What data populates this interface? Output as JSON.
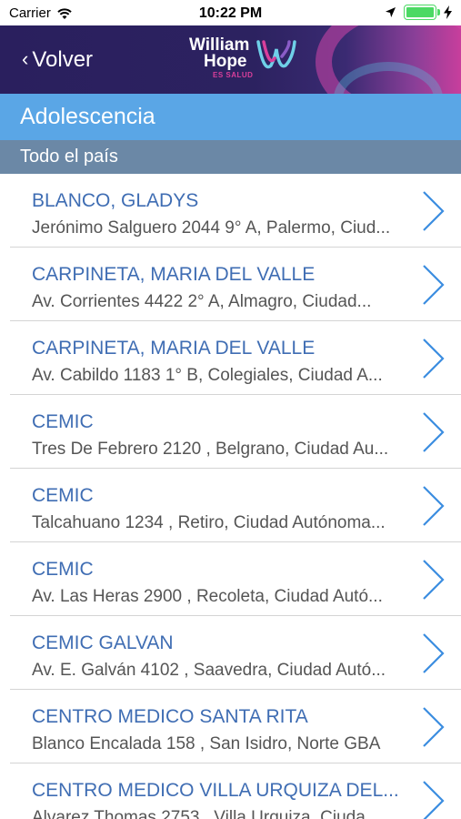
{
  "status_bar": {
    "carrier": "Carrier",
    "time": "10:22 PM",
    "battery_level": 1.0,
    "battery_color": "#4cd964"
  },
  "nav": {
    "back_label": "Volver",
    "back_icon": "chevron-left-icon",
    "logo_line1": "William",
    "logo_line2": "Hope",
    "logo_tagline": "ES SALUD",
    "brand_colors": {
      "primary": "#2a1f5e",
      "accent_pink": "#d93f9b",
      "accent_blue": "#5aa6e6"
    }
  },
  "section": {
    "title": "Adolescencia",
    "region": "Todo el país"
  },
  "providers": [
    {
      "name": "BLANCO, GLADYS",
      "address": "Jerónimo Salguero 2044 9° A, Palermo, Ciud..."
    },
    {
      "name": "CARPINETA, MARIA DEL VALLE",
      "address": "Av. Corrientes 4422 2° A, Almagro, Ciudad..."
    },
    {
      "name": "CARPINETA, MARIA DEL VALLE",
      "address": "Av. Cabildo 1183 1° B, Colegiales, Ciudad A..."
    },
    {
      "name": "CEMIC",
      "address": "Tres De Febrero 2120 , Belgrano, Ciudad Au..."
    },
    {
      "name": "CEMIC",
      "address": "Talcahuano 1234 , Retiro, Ciudad Autónoma..."
    },
    {
      "name": "CEMIC",
      "address": "Av. Las Heras 2900  , Recoleta, Ciudad Autó..."
    },
    {
      "name": "CEMIC GALVAN",
      "address": "Av. E. Galván 4102 , Saavedra, Ciudad Autó..."
    },
    {
      "name": "CENTRO MEDICO SANTA RITA",
      "address": "Blanco Encalada 158 , San Isidro, Norte GBA"
    },
    {
      "name": "CENTRO MEDICO VILLA URQUIZA DEL...",
      "address": "Alvarez Thomas 2753 , Villa Urquiza, Ciuda..."
    }
  ]
}
